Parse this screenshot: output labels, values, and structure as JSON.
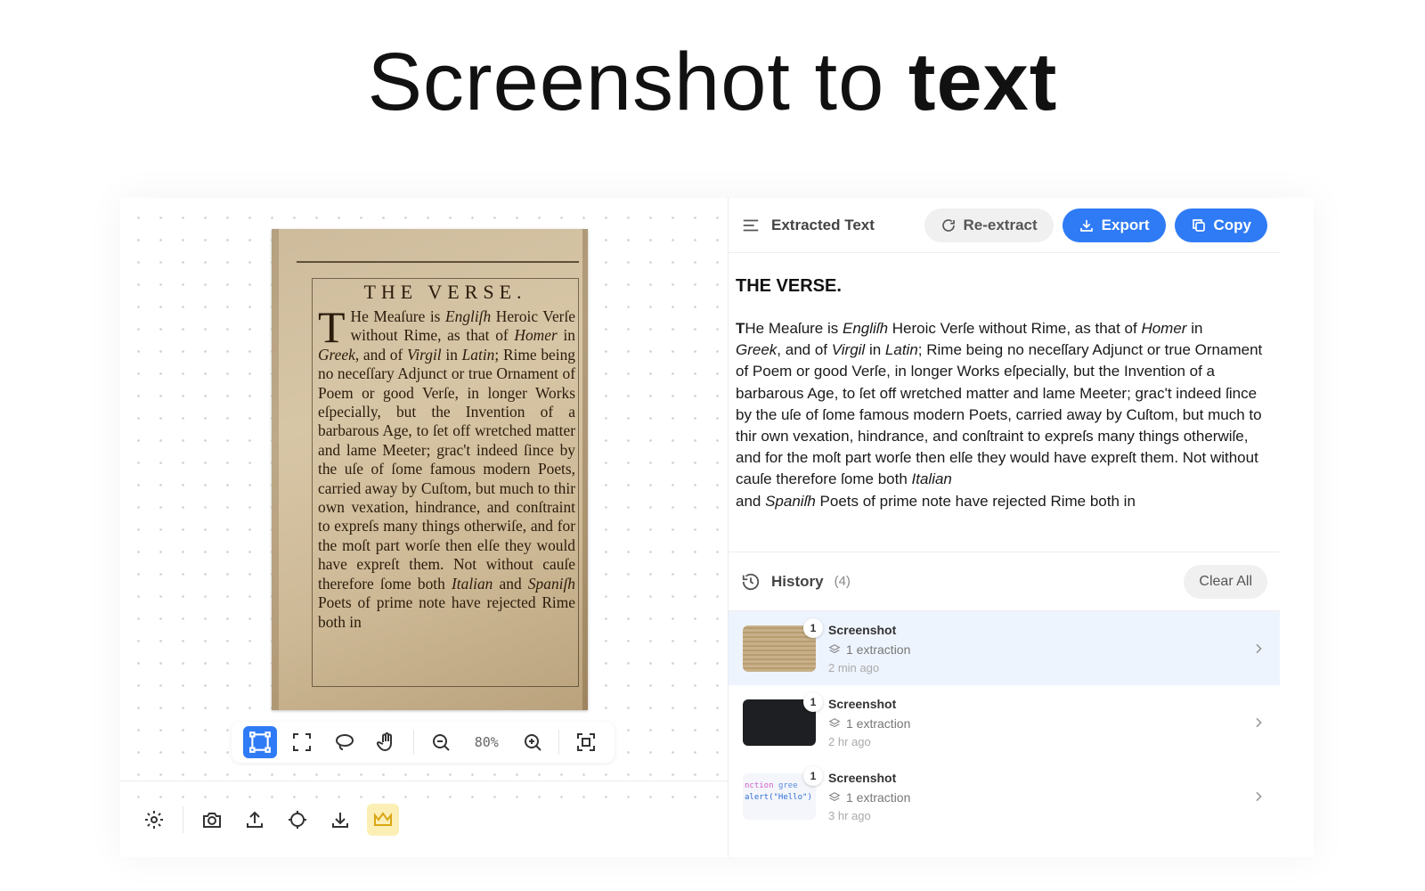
{
  "hero": {
    "title_regular": "Screenshot to ",
    "title_bold": "text"
  },
  "document": {
    "heading": "THE VERSE.",
    "dropcap": "T",
    "text_1": "He Meaſure is ",
    "text_1_i": "Engliſh",
    "text_2": " Heroic Verſe without Rime, as that of ",
    "text_2_i": "Homer",
    "text_3": " in ",
    "text_3_i": "Greek",
    "text_4": ", and of ",
    "text_4_i": "Virgil",
    "text_5": " in ",
    "text_5_i": "Latin",
    "text_6": "; Rime being no neceſſary Adjunct or true Ornament of Poem or good Verſe, in longer Works eſpecially, but the Invention of a barbarous Age, to ſet off wretched matter and lame Meeter; grac't indeed ſince by the uſe of ſome famous modern Poets, carried away by Cuſtom, but much to thir own vexation, hindrance, and conſtraint to expreſs many things otherwiſe, and for the moſt part worſe then elſe they would have expreſt them. Not without cauſe therefore ſome both ",
    "text_6_i": "Italian",
    "text_7": " and ",
    "text_7_i": "Spaniſh",
    "text_8": " Poets of prime note have rejected Rime both in"
  },
  "toolbar": {
    "zoom_label": "80%",
    "icons": [
      "select-region-icon",
      "fullscreen-select-icon",
      "lasso-icon",
      "hand-icon",
      "zoom-out-icon",
      "zoom-in-icon",
      "fit-screen-icon"
    ]
  },
  "bottom_bar": {
    "icons": [
      "settings-icon",
      "camera-icon",
      "upload-icon",
      "crosshair-icon",
      "download-icon",
      "crown-icon"
    ]
  },
  "panel": {
    "title": "Extracted Text",
    "reextract_label": "Re-extract",
    "export_label": "Export",
    "copy_label": "Copy",
    "extracted": {
      "heading": "THE VERSE.",
      "p_bold": "T",
      "p1": "He Meaſure is ",
      "p1_i": "Engliſh",
      "p2": " Heroic Verſe without Rime, as that of ",
      "p2_i": "Homer",
      "p3": " in ",
      "p3_i": "Greek",
      "p4": ", and of ",
      "p4_i": "Virgil",
      "p5": " in ",
      "p5_i": "Latin",
      "p6": "; Rime being no neceſſary Adjunct or true Ornament of Poem or good Verſe, in longer Works eſpecially, but the Invention of a barbarous Age, to ſet off wretched matter and lame Meeter; grac't indeed ſince by the uſe of ſome famous modern Poets, carried away by Cuſtom, but much to thir own vexation, hindrance, and conſtraint to expreſs many things otherwiſe, and for the moſt part worſe then elſe they would have expreſt them. Not without cauſe therefore ſome both ",
      "p6_i": "Italian",
      "p7": "and ",
      "p7_i": "Spaniſh",
      "p8": " Poets of prime note have rejected Rime both in"
    }
  },
  "history": {
    "title": "History",
    "count": "(4)",
    "clear_label": "Clear All",
    "items": [
      {
        "name": "Screenshot",
        "badge": "1",
        "extractions": "1 extraction",
        "time": "2 min ago"
      },
      {
        "name": "Screenshot",
        "badge": "1",
        "extractions": "1 extraction",
        "time": "2 hr ago"
      },
      {
        "name": "Screenshot",
        "badge": "1",
        "extractions": "1 extraction",
        "time": "3 hr ago",
        "code_1a": "nction",
        "code_1b": "gree",
        "code_2": "alert(\"Hello\")"
      }
    ]
  },
  "colors": {
    "accent": "#2f7bf5",
    "premium_bg": "#fbefb5",
    "selected_row": "#eef4fe"
  }
}
